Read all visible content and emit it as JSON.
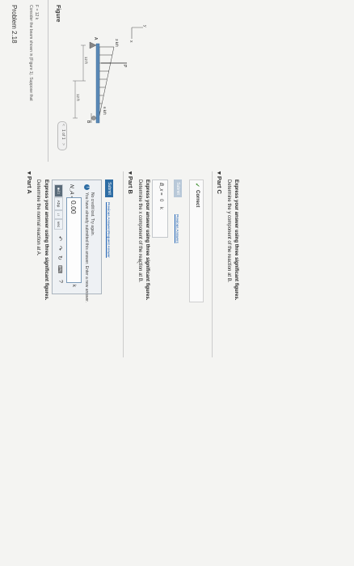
{
  "problem": {
    "title": "Problem 2.18"
  },
  "left": {
    "intro_line1": "Consider the beam shown in (Figure 1). Suppose that",
    "intro_line2": "F = 12 k",
    "figure_label": "Figure",
    "pager": "1 of 1",
    "pager_prev": "<",
    "pager_next": ">",
    "diagram": {
      "axis_y": "y",
      "axis_x": "x",
      "load_a": "3 k/ft",
      "load_b": "6 k/ft",
      "label_p": "P",
      "label_a": "A",
      "label_b": "B",
      "dim_1": "12 ft",
      "dim_2": "12 ft"
    }
  },
  "partA": {
    "header": "Part A",
    "prompt": "Determine the normal reaction at A.",
    "instruction": "Express your answer using three significant figures.",
    "toolbar": {
      "templates": "■√□",
      "symbols": "AΣφ",
      "arrows": "↓↑",
      "vec": "vec",
      "undo": "↶",
      "redo": "↷",
      "reset": "↻",
      "keyboard": "⌨",
      "help": "?"
    },
    "var_label": "N_A =",
    "value": "0.00",
    "unit": "k",
    "feedback_line1": "You have already submitted this answer. Enter a new answer.",
    "feedback_line2": "No credit lost. Try again.",
    "submit": "Submit",
    "previous": "Previous Answers",
    "request": "Request Answer"
  },
  "partB": {
    "header": "Part B",
    "prompt": "Determine the x component of the reaction at B.",
    "instruction": "Express your answer using three significant figures.",
    "var_label": "B_x =",
    "value": "0",
    "unit": "k",
    "submit": "Submit",
    "previous": "Previous Answers",
    "status": "Correct"
  },
  "partC": {
    "header": "Part C",
    "prompt": "Determine the y component of the reaction at B.",
    "instruction": "Express your answer using three significant figures."
  },
  "colors": {
    "accent": "#2e6da4",
    "correct": "#3f8f2f",
    "feedback": "#2e6da4"
  }
}
